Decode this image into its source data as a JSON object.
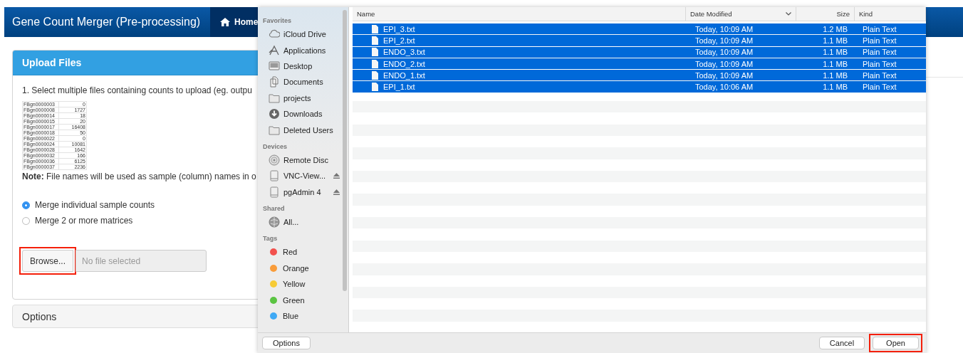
{
  "app": {
    "title": "Gene Count Merger (Pre-processing)",
    "nav": [
      {
        "label": "Home",
        "selected": true
      }
    ]
  },
  "upload_panel": {
    "title": "Upload Files",
    "instruction": "1. Select multiple files containing counts to upload (eg. outpu",
    "example_table": {
      "rows": [
        [
          "FBgn0000003",
          "0"
        ],
        [
          "FBgn0000008",
          "1727"
        ],
        [
          "FBgn0000014",
          "18"
        ],
        [
          "FBgn0000015",
          "20"
        ],
        [
          "FBgn0000017",
          "16408"
        ],
        [
          "FBgn0000018",
          "50"
        ],
        [
          "FBgn0000022",
          "0"
        ],
        [
          "FBgn0000024",
          "10081"
        ],
        [
          "FBgn0000028",
          "1642"
        ],
        [
          "FBgn0000032",
          "166"
        ],
        [
          "FBgn0000036",
          "6125"
        ],
        [
          "FBgn0000037",
          "2236"
        ]
      ]
    },
    "note": "**Note:** File names will be used as sample (column) names in o",
    "merge_options": [
      {
        "label": "Merge individual sample counts",
        "selected": true
      },
      {
        "label": "Merge 2 or more matrices",
        "selected": false
      }
    ],
    "browse": {
      "label": "Browse...",
      "highlighted": true
    },
    "file_field": {
      "placeholder": "No file selected"
    }
  },
  "options_panel": {
    "title": "Options"
  },
  "file_dialog": {
    "sidebar": [
      {
        "heading": "Favorites",
        "items": [
          {
            "label": "iCloud Drive",
            "kind": "cloud"
          },
          {
            "label": "Applications",
            "kind": "apps"
          },
          {
            "label": "Desktop",
            "kind": "desktop"
          },
          {
            "label": "Documents",
            "kind": "documents"
          },
          {
            "label": "projects",
            "kind": "folder"
          },
          {
            "label": "Downloads",
            "kind": "download"
          },
          {
            "label": "Deleted Users",
            "kind": "folder"
          }
        ]
      },
      {
        "heading": "Devices",
        "items": [
          {
            "label": "Remote Disc",
            "kind": "disc"
          },
          {
            "label": "VNC-View...",
            "kind": "drive",
            "ejectable": true
          },
          {
            "label": "pgAdmin 4",
            "kind": "drive",
            "ejectable": true
          }
        ]
      },
      {
        "heading": "Shared",
        "items": [
          {
            "label": "All...",
            "kind": "network"
          }
        ]
      },
      {
        "heading": "Tags",
        "items": [
          {
            "label": "Red",
            "kind": "tag",
            "color": "#f2514d"
          },
          {
            "label": "Orange",
            "kind": "tag",
            "color": "#f99c3a"
          },
          {
            "label": "Yellow",
            "kind": "tag",
            "color": "#f7cb35"
          },
          {
            "label": "Green",
            "kind": "tag",
            "color": "#5bc442"
          },
          {
            "label": "Blue",
            "kind": "tag",
            "color": "#3fa9f5"
          }
        ]
      }
    ],
    "columns": [
      {
        "label": "Name",
        "sorted": false
      },
      {
        "label": "Date Modified",
        "sorted": true
      },
      {
        "label": "Size",
        "sorted": false
      },
      {
        "label": "Kind",
        "sorted": false
      }
    ],
    "files": [
      {
        "name": "EPI_3.txt",
        "modified": "Today, 10:09 AM",
        "size": "1.2 MB",
        "kind": "Plain Text",
        "selected": true
      },
      {
        "name": "EPI_2.txt",
        "modified": "Today, 10:09 AM",
        "size": "1.1 MB",
        "kind": "Plain Text",
        "selected": true
      },
      {
        "name": "ENDO_3.txt",
        "modified": "Today, 10:09 AM",
        "size": "1.1 MB",
        "kind": "Plain Text",
        "selected": true
      },
      {
        "name": "ENDO_2.txt",
        "modified": "Today, 10:09 AM",
        "size": "1.1 MB",
        "kind": "Plain Text",
        "selected": true
      },
      {
        "name": "ENDO_1.txt",
        "modified": "Today, 10:09 AM",
        "size": "1.1 MB",
        "kind": "Plain Text",
        "selected": true
      },
      {
        "name": "EPI_1.txt",
        "modified": "Today, 10:06 AM",
        "size": "1.1 MB",
        "kind": "Plain Text",
        "selected": true
      }
    ],
    "buttons": [
      {
        "label": "Options",
        "kind": "left",
        "highlighted": false
      },
      {
        "label": "Cancel",
        "kind": "right",
        "highlighted": false
      },
      {
        "label": "Open",
        "kind": "right",
        "highlighted": true
      }
    ]
  }
}
